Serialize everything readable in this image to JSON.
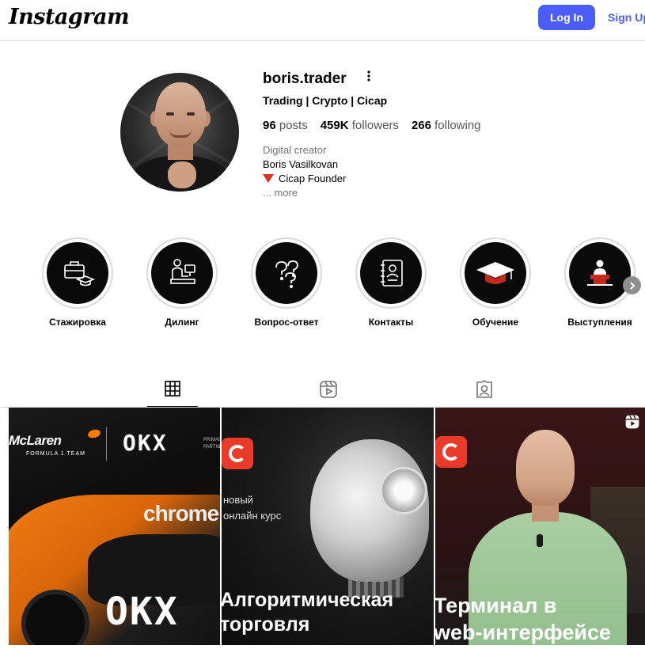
{
  "header": {
    "logo": "Instagram",
    "login_label": "Log In",
    "signup_label": "Sign Up"
  },
  "profile": {
    "username": "boris.trader",
    "more_icon": "more-dots-icon",
    "tagline": "Trading | Crypto | Cicap",
    "stats": {
      "posts_count": "96",
      "posts_label": "posts",
      "followers_count": "459K",
      "followers_label": "followers",
      "following_count": "266",
      "following_label": "following"
    },
    "bio": {
      "category": "Digital creator",
      "name": "Boris Vasilkovan",
      "line": "Cicap Founder",
      "more": "... more"
    }
  },
  "highlights": [
    {
      "label": "Стажировка",
      "icon": "briefcase-graduation-icon"
    },
    {
      "label": "Дилинг",
      "icon": "trader-desk-icon"
    },
    {
      "label": "Вопрос-ответ",
      "icon": "question-marks-icon"
    },
    {
      "label": "Контакты",
      "icon": "contact-book-icon"
    },
    {
      "label": "Обучение",
      "icon": "graduation-cap-icon"
    },
    {
      "label": "Выступления",
      "icon": "speaker-podium-icon"
    }
  ],
  "tabs": [
    {
      "name": "posts",
      "icon": "grid-icon",
      "active": true
    },
    {
      "name": "reels",
      "icon": "reels-icon",
      "active": false
    },
    {
      "name": "tagged",
      "icon": "tagged-icon",
      "active": false
    }
  ],
  "posts": [
    {
      "brand_left": "McLaren",
      "brand_left_sub": "FORMULA 1 TEAM",
      "brand_right": "OKX",
      "brand_right_sub": "PRIMARY PARTNER",
      "car_text": "chrome",
      "car_logo": "OKX"
    },
    {
      "subtitle_line1": "новый",
      "subtitle_line2": "онлайн курс",
      "title_line1": "Алгоритмическая",
      "title_line2": "торговля"
    },
    {
      "title_line1": "Терминал в",
      "title_line2": "web-интерфейсе",
      "type_icon": "reels-icon"
    }
  ],
  "colors": {
    "accent": "#4a5df9",
    "badge_red": "#e93a2a",
    "border": "#dbdbdb"
  }
}
